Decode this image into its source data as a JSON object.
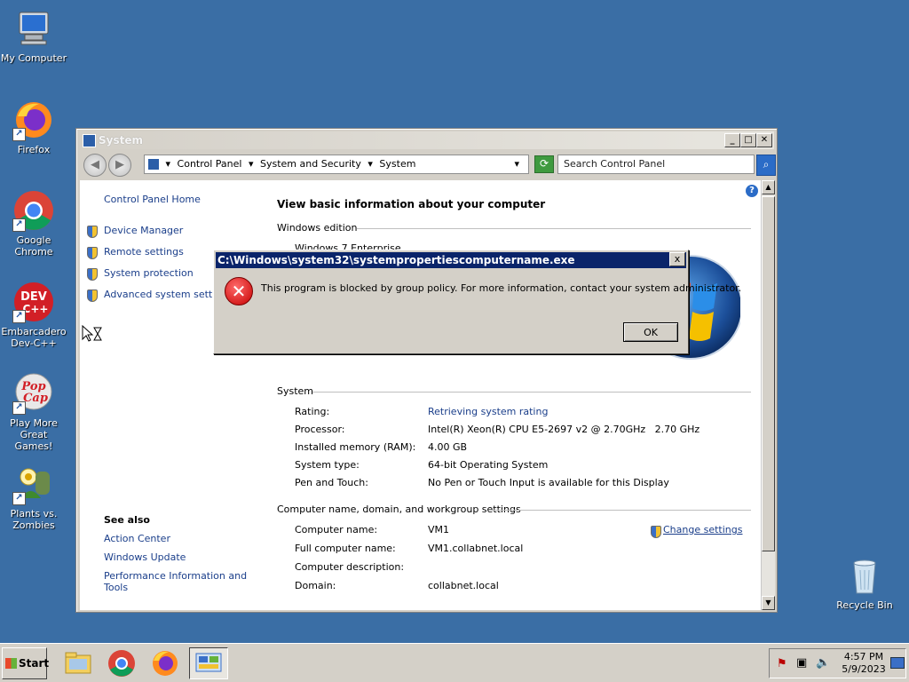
{
  "desktop": {
    "icons": [
      {
        "label": "My Computer",
        "icon": "computer-icon"
      },
      {
        "label": "Firefox",
        "icon": "firefox-icon"
      },
      {
        "label": "Google Chrome",
        "icon": "chrome-icon"
      },
      {
        "label_line1": "Embarcadero",
        "label_line2": "Dev-C++",
        "icon": "devcpp-icon"
      },
      {
        "label_line1": "Play More",
        "label_line2": "Great Games!",
        "icon": "popcap-icon"
      },
      {
        "label_line1": "Plants vs.",
        "label_line2": "Zombies",
        "icon": "plants-vs-zombies-icon"
      },
      {
        "label": "Recycle Bin",
        "icon": "recycle-bin-icon"
      }
    ],
    "background_color": "#3a6ea5"
  },
  "window": {
    "title": "System",
    "breadcrumbs": [
      "Control Panel",
      "System and Security",
      "System"
    ],
    "search_placeholder": "Search Control Panel",
    "sidebar": {
      "home": "Control Panel Home",
      "links": [
        "Device Manager",
        "Remote settings",
        "System protection",
        "Advanced system settings"
      ],
      "see_also_title": "See also",
      "see_also": [
        "Action Center",
        "Windows Update",
        "Performance Information and",
        "Tools"
      ]
    },
    "main": {
      "heading": "View basic information about your computer",
      "edition_section": "Windows edition",
      "edition_value": "Windows 7 Enterprise",
      "system_section": "System",
      "system_rows": [
        {
          "label": "Rating:",
          "value": "Retrieving system rating"
        },
        {
          "label": "Processor:",
          "value": "Intel(R) Xeon(R) CPU E5-2697 v2 @ 2.70GHz   2.70 GHz"
        },
        {
          "label": "Installed memory (RAM):",
          "value": "4.00 GB"
        },
        {
          "label": "System type:",
          "value": "64-bit Operating System"
        },
        {
          "label": "Pen and Touch:",
          "value": "No Pen or Touch Input is available for this Display"
        }
      ],
      "computer_section": "Computer name, domain, and workgroup settings",
      "computer_rows": [
        {
          "label": "Computer name:",
          "value": "VM1"
        },
        {
          "label": "Full computer name:",
          "value": "VM1.collabnet.local"
        },
        {
          "label": "Computer description:",
          "value": ""
        },
        {
          "label": "Domain:",
          "value": "collabnet.local"
        }
      ],
      "change_settings": "Change settings"
    }
  },
  "dialog": {
    "title": "C:\\Windows\\system32\\systempropertiescomputername.exe",
    "message": "This program is blocked by group policy. For more information, contact your system administrator.",
    "ok_label": "OK",
    "close_label": "x",
    "error_glyph": "✕"
  },
  "taskbar": {
    "start_label": "Start",
    "apps": [
      "file-explorer-icon",
      "chrome-icon",
      "firefox-icon",
      "control-panel-icon"
    ],
    "time": "4:57 PM",
    "date": "5/9/2023"
  }
}
